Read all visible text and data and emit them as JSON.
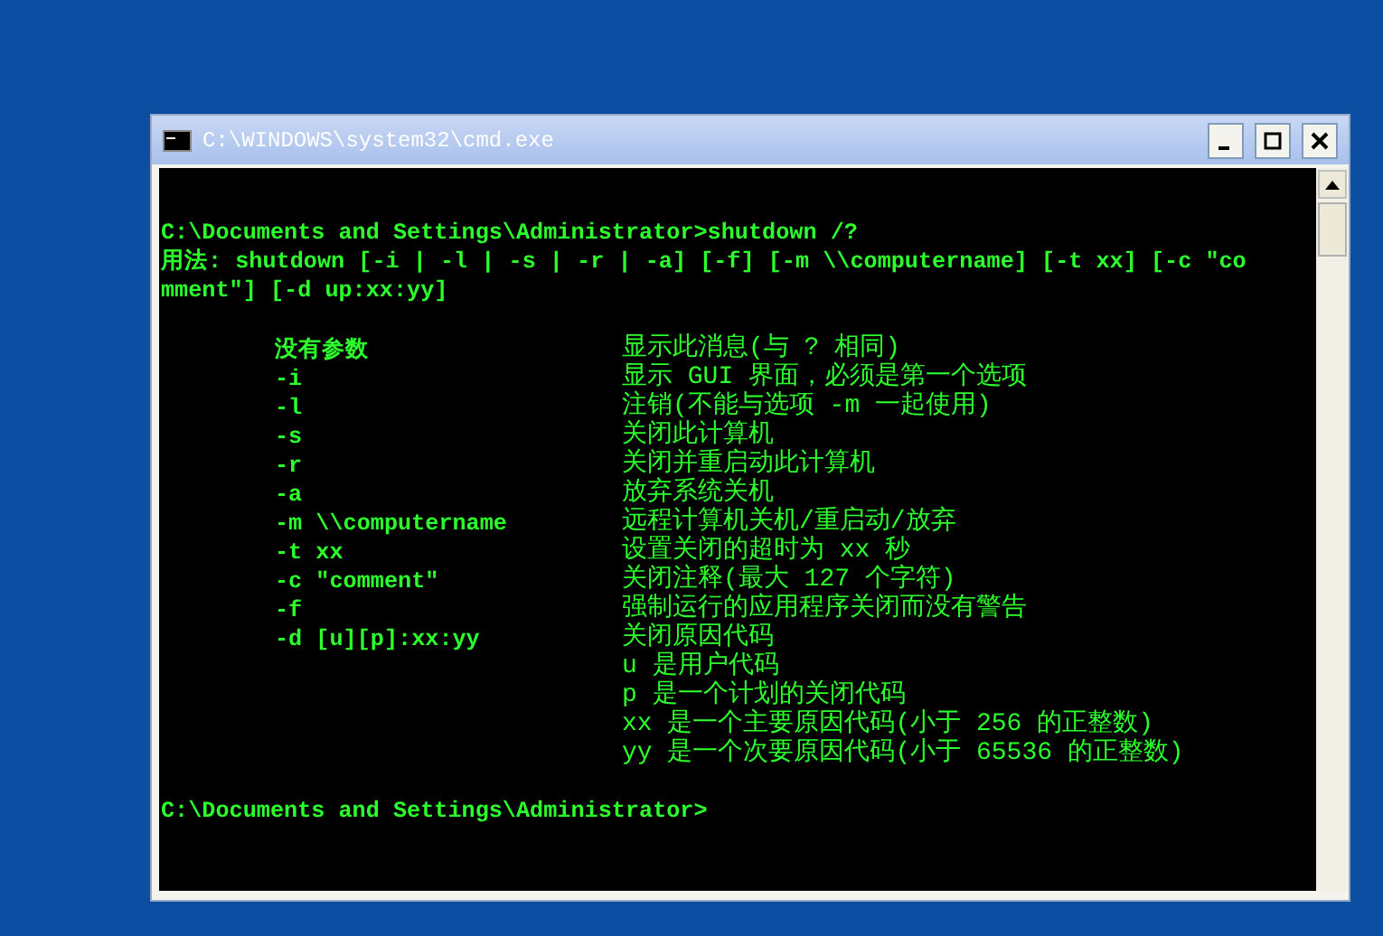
{
  "window": {
    "title": "C:\\WINDOWS\\system32\\cmd.exe"
  },
  "console": {
    "command_line": "C:\\Documents and Settings\\Administrator>shutdown /?",
    "usage": [
      "用法: shutdown [-i | -l | -s | -r | -a] [-f] [-m \\\\computername] [-t xx] [-c \"co",
      "mment\"] [-d up:xx:yy]"
    ],
    "options": [
      {
        "option": "没有参数",
        "description": "显示此消息(与 ? 相同)"
      },
      {
        "option": "-i",
        "description": "显示 GUI 界面，必须是第一个选项"
      },
      {
        "option": "-l",
        "description": "注销(不能与选项 -m 一起使用)"
      },
      {
        "option": "-s",
        "description": "关闭此计算机"
      },
      {
        "option": "-r",
        "description": "关闭并重启动此计算机"
      },
      {
        "option": "-a",
        "description": "放弃系统关机"
      },
      {
        "option": "-m \\\\computername",
        "description": "远程计算机关机/重启动/放弃"
      },
      {
        "option": "-t xx",
        "description": "设置关闭的超时为 xx 秒"
      },
      {
        "option": "-c \"comment\"",
        "description": "关闭注释(最大 127 个字符)"
      },
      {
        "option": "-f",
        "description": "强制运行的应用程序关闭而没有警告"
      },
      {
        "option": "-d [u][p]:xx:yy",
        "description": "关闭原因代码"
      },
      {
        "description": "u 是用户代码"
      },
      {
        "description": "p 是一个计划的关闭代码"
      },
      {
        "description": "xx 是一个主要原因代码(小于 256 的正整数)"
      },
      {
        "description": "yy 是一个次要原因代码(小于 65536 的正整数)"
      }
    ],
    "prompt": "C:\\Documents and Settings\\Administrator>"
  }
}
